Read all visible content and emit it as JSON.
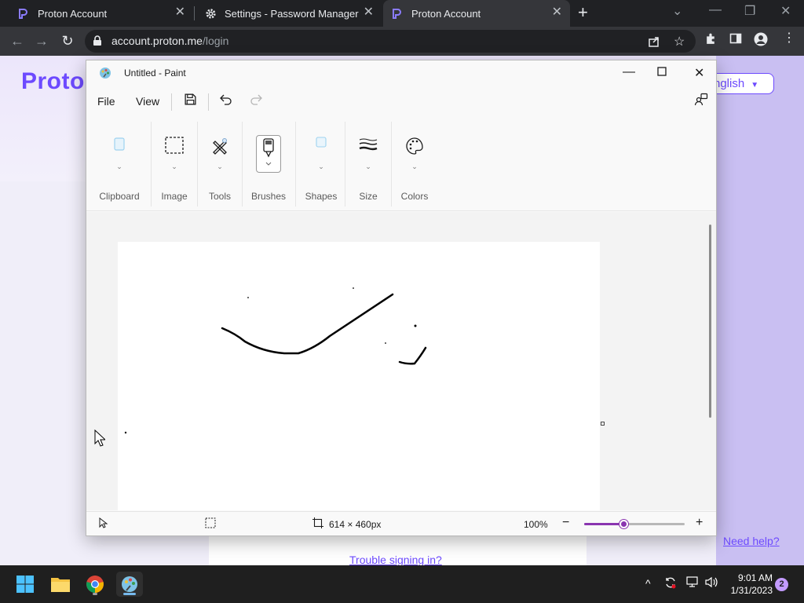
{
  "browser": {
    "tabs": [
      {
        "title": "Proton Account",
        "icon": "proton-icon",
        "active": false
      },
      {
        "title": "Settings - Password Manager",
        "icon": "gear-icon",
        "active": false
      },
      {
        "title": "Proton Account",
        "icon": "proton-icon",
        "active": true
      }
    ],
    "url_host": "account.proton.me",
    "url_path": "/login"
  },
  "page": {
    "logo_text": "Proton",
    "language": "nglish",
    "trouble_link": "Trouble signing in?",
    "help_link": "Need help?"
  },
  "paint": {
    "window_title": "Untitled - Paint",
    "menu": {
      "file": "File",
      "view": "View"
    },
    "ribbon": {
      "groups": [
        "Clipboard",
        "Image",
        "Tools",
        "Brushes",
        "Shapes",
        "Size",
        "Colors"
      ]
    },
    "status": {
      "canvas_size": "614 × 460px",
      "zoom": "100%",
      "zoom_level": 0.4
    }
  },
  "taskbar": {
    "time": "9:01 AM",
    "date": "1/31/2023",
    "notifications": "2"
  },
  "colors": {
    "accent": "#6d4aff",
    "paint_accent": "#8a35b0"
  }
}
